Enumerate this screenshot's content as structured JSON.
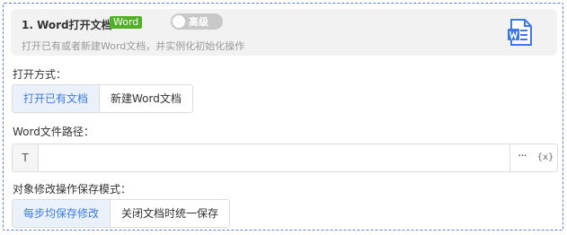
{
  "header": {
    "title": "1. Word打开文档",
    "tag": "Word",
    "toggle_label": "高级",
    "description": "打开已有或者新建Word文档，并实例化初始化操作",
    "icon": "word-document-icon",
    "accent_color": "#3c7be6",
    "tag_color": "#52b026"
  },
  "open_mode": {
    "label": "打开方式：",
    "options": [
      "打开已有文档",
      "新建Word文档"
    ],
    "selected": "打开已有文档"
  },
  "file_path": {
    "label": "Word文件路径：",
    "type_button": "T",
    "value": "",
    "more_button": "···",
    "variable_button": "{x}"
  },
  "save_mode": {
    "label": "对象修改操作保存模式：",
    "options": [
      "每步均保存修改",
      "关闭文档时统一保存"
    ],
    "selected": "每步均保存修改"
  }
}
